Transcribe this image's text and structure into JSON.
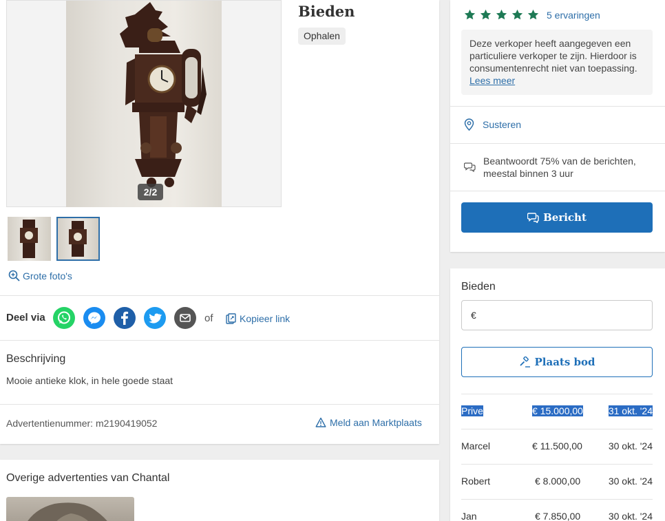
{
  "listing": {
    "photo_counter": "2/2",
    "big_photos_label": "Grote foto's",
    "price_label": "Bieden",
    "delivery_pill": "Ophalen"
  },
  "share": {
    "label": "Deel via",
    "or_label": "of",
    "copy_link_label": "Kopieer link",
    "icons": [
      "whatsapp-icon",
      "messenger-icon",
      "facebook-icon",
      "twitter-icon",
      "email-icon"
    ],
    "colors": {
      "whatsapp": "#25d366",
      "messenger": "#1a8cf0",
      "facebook": "#1f5fa8",
      "twitter": "#1d9bf0",
      "email": "#555555"
    }
  },
  "description": {
    "heading": "Beschrijving",
    "text": "Mooie antieke klok, in hele goede staat"
  },
  "ad_meta": {
    "ad_number": "Advertentienummer: m2190419052",
    "report_label": "Meld aan Marktplaats"
  },
  "other_ads": {
    "heading": "Overige advertenties van Chantal"
  },
  "seller": {
    "rating_stars": 5,
    "reviews_label": "5 ervaringen",
    "notice_text": "Deze verkoper heeft aangegeven een particuliere verkoper te zijn. Hierdoor is consumentenrecht niet van toepassing.",
    "notice_link": "Lees meer",
    "location": "Susteren",
    "response": "Beantwoordt 75% van de berichten, meestal binnen 3 uur",
    "message_button": "Bericht"
  },
  "bidding": {
    "heading": "Bieden",
    "currency_symbol": "€",
    "place_bid_button": "Plaats bod",
    "bids": [
      {
        "name": "Prive",
        "amount": "€ 15.000,00",
        "date": "31 okt. '24"
      },
      {
        "name": "Marcel",
        "amount": "€ 11.500,00",
        "date": "30 okt. '24"
      },
      {
        "name": "Robert",
        "amount": "€ 8.000,00",
        "date": "30 okt. '24"
      },
      {
        "name": "Jan",
        "amount": "€ 7.850,00",
        "date": "30 okt. '24"
      }
    ]
  },
  "colors": {
    "accent": "#1e6fb8",
    "link": "#2d6ea8",
    "star": "#1e7a55"
  }
}
